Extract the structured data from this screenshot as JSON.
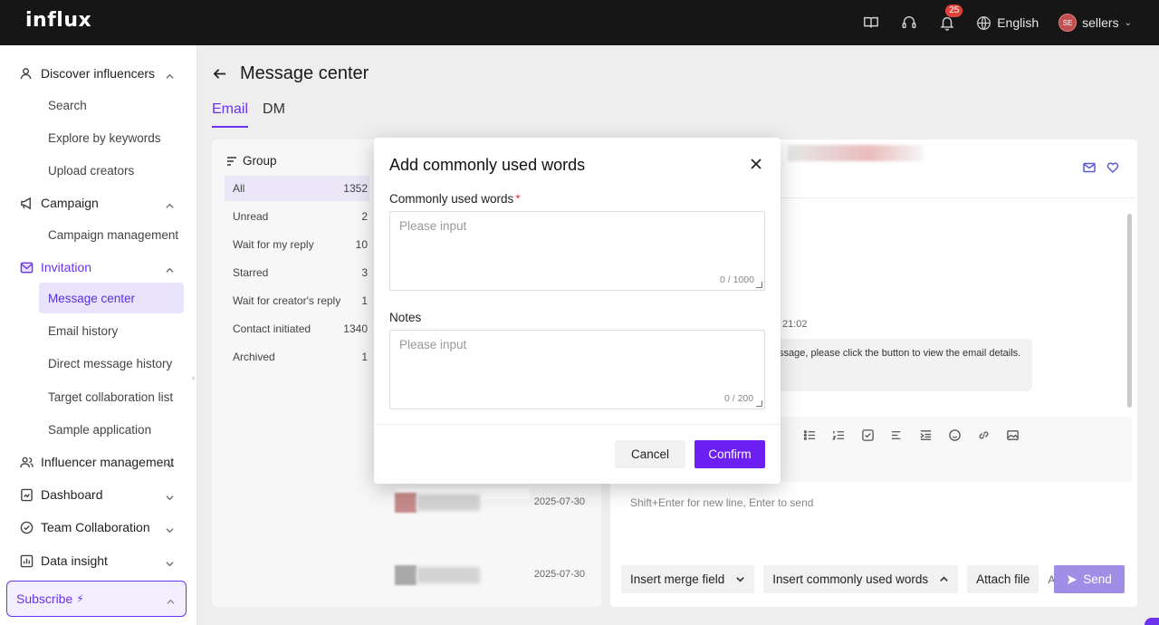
{
  "app": {
    "logo": "influx"
  },
  "topbar": {
    "notification_count": "25",
    "language": "English",
    "user_initials": "SE",
    "user_name": "sellers"
  },
  "sidebar": {
    "groups": [
      {
        "label": "Discover influencers",
        "icon": "user-search-icon"
      },
      {
        "label": "Campaign",
        "icon": "megaphone-icon"
      },
      {
        "label": "Invitation",
        "icon": "mail-icon"
      },
      {
        "label": "Influencer management",
        "icon": "users-icon"
      },
      {
        "label": "Dashboard",
        "icon": "dashboard-icon"
      },
      {
        "label": "Team Collaboration",
        "icon": "team-icon"
      },
      {
        "label": "Data insight",
        "icon": "chart-icon"
      }
    ],
    "discover_items": [
      "Search",
      "Explore by keywords",
      "Upload creators"
    ],
    "campaign_items": [
      "Campaign management"
    ],
    "invitation_items": [
      "Message center",
      "Email history",
      "Direct message history",
      "Target collaboration list",
      "Sample application"
    ],
    "subscribe_label": "Subscribe"
  },
  "page": {
    "title": "Message center",
    "tabs": [
      "Email",
      "DM"
    ]
  },
  "groups_panel": {
    "title": "Group",
    "rows": [
      {
        "label": "All",
        "count": "1352"
      },
      {
        "label": "Unread",
        "count": "2"
      },
      {
        "label": "Wait for my reply",
        "count": "10"
      },
      {
        "label": "Starred",
        "count": "3"
      },
      {
        "label": "Wait for creator's reply",
        "count": "1"
      },
      {
        "label": "Contact initiated",
        "count": "1340"
      },
      {
        "label": "Archived",
        "count": "1"
      }
    ],
    "conversation_dates": [
      "2025-07-30",
      "2025-07-30"
    ]
  },
  "message": {
    "time_fragment": "21:02",
    "bubble_text": "ssage, please click the button to view the email details."
  },
  "composer": {
    "hint": "Shift+Enter for new line, Enter to send",
    "insert_merge_field": "Insert merge field",
    "insert_common_words": "Insert commonly used words",
    "attach_file": "Attach file",
    "attach_truncated": "Att...",
    "send": "Send"
  },
  "modal": {
    "title": "Add commonly used words",
    "field1_label": "Commonly used words",
    "field1_placeholder": "Please input",
    "field1_counter": "0 / 1000",
    "field2_label": "Notes",
    "field2_placeholder": "Please input",
    "field2_counter": "0 / 200",
    "cancel": "Cancel",
    "confirm": "Confirm"
  },
  "colors": {
    "accent": "#6b33f0",
    "topbar": "#161617",
    "badge": "#e0413a"
  }
}
